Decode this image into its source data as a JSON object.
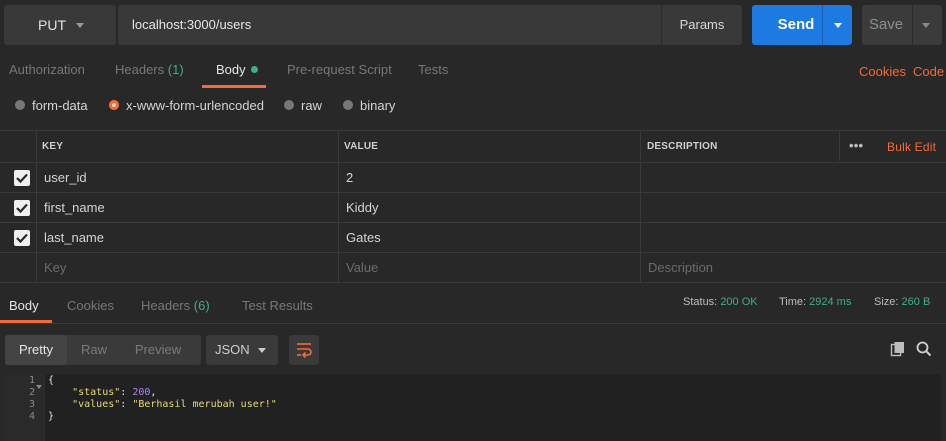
{
  "request": {
    "method": "PUT",
    "url": "localhost:3000/users",
    "params_label": "Params",
    "send_label": "Send",
    "save_label": "Save"
  },
  "request_tabs": [
    {
      "label": "Authorization"
    },
    {
      "label": "Headers",
      "count": "(1)"
    },
    {
      "label": "Body"
    },
    {
      "label": "Pre-request Script"
    },
    {
      "label": "Tests"
    }
  ],
  "links": {
    "cookies": "Cookies",
    "code": "Code"
  },
  "body_types": [
    {
      "label": "form-data",
      "selected": false
    },
    {
      "label": "x-www-form-urlencoded",
      "selected": true
    },
    {
      "label": "raw",
      "selected": false
    },
    {
      "label": "binary",
      "selected": false
    }
  ],
  "table": {
    "headers": {
      "key": "KEY",
      "value": "VALUE",
      "description": "DESCRIPTION"
    },
    "more_label": "•••",
    "bulk_edit_label": "Bulk Edit",
    "rows": [
      {
        "checked": true,
        "key": "user_id",
        "value": "2",
        "description": ""
      },
      {
        "checked": true,
        "key": "first_name",
        "value": "Kiddy",
        "description": ""
      },
      {
        "checked": true,
        "key": "last_name",
        "value": "Gates",
        "description": ""
      }
    ],
    "placeholder": {
      "key": "Key",
      "value": "Value",
      "description": "Description"
    }
  },
  "response_tabs": [
    {
      "label": "Body"
    },
    {
      "label": "Cookies"
    },
    {
      "label": "Headers",
      "count": "(6)"
    },
    {
      "label": "Test Results"
    }
  ],
  "status": {
    "status_label": "Status:",
    "status_value": "200 OK",
    "time_label": "Time:",
    "time_value": "2924 ms",
    "size_label": "Size:",
    "size_value": "260 B"
  },
  "formats": [
    "Pretty",
    "Raw",
    "Preview"
  ],
  "language": "JSON",
  "code": {
    "line_numbers": [
      "1",
      "2",
      "3",
      "4"
    ],
    "open": "{",
    "line2_key": "\"status\"",
    "line2_sep": ": ",
    "line2_val": "200",
    "line2_end": ",",
    "line3_key": "\"values\"",
    "line3_sep": ": ",
    "line3_val": "\"Berhasil merubah user!\"",
    "close": "}"
  },
  "colors": {
    "accent": "#f26b3a",
    "send": "#1c7ae0",
    "status_green": "#3fae8c"
  },
  "icons": [
    "caret-down-icon",
    "checkmark-icon",
    "copy-icon",
    "search-icon",
    "wrap-lines-icon",
    "fold-arrow-icon",
    "more-dots-icon"
  ]
}
